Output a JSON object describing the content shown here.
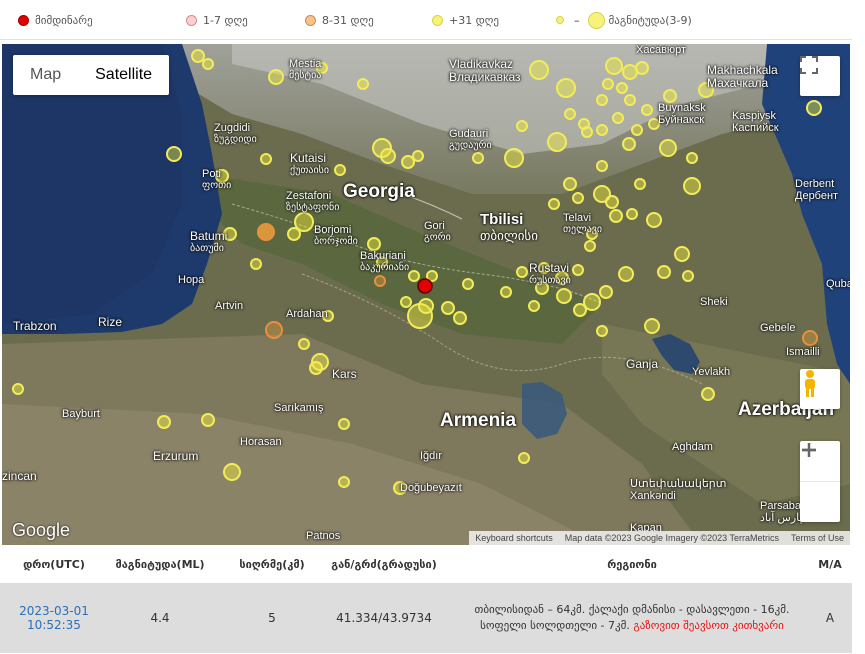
{
  "legend": {
    "today": "მიმდინარე",
    "d1_7": "1-7 დღე",
    "d8_31": "8-31 დღე",
    "d31plus": "+31 დღე",
    "magnitude": "მაგნიტუდა(3-9)",
    "dash": "–"
  },
  "map": {
    "map_btn": "Map",
    "satellite_btn": "Satellite",
    "google_logo": "Google",
    "attribution": {
      "shortcuts": "Keyboard shortcuts",
      "data": "Map data ©2023 Google Imagery ©2023 TerraMetrics",
      "terms": "Terms of Use"
    },
    "labels": [
      {
        "key": "mestia",
        "text": "Mestia",
        "sub": "მესტია"
      },
      {
        "key": "vladikavkaz",
        "text": "Vladikavkaz",
        "sub": "Владикавказ"
      },
      {
        "key": "khasavyurt",
        "text": "Хасавюрт",
        "sub": ""
      },
      {
        "key": "makhachkala",
        "text": "Makhachkala",
        "sub": "Махачкала"
      },
      {
        "key": "buynaksk",
        "text": "Buynaksk",
        "sub": "Буйнакск"
      },
      {
        "key": "kaspiysk",
        "text": "Kaspiysk",
        "sub": "Каспийск"
      },
      {
        "key": "zugdidi",
        "text": "Zugdidi",
        "sub": "ზუგდიდი"
      },
      {
        "key": "gudauri",
        "text": "Gudauri",
        "sub": "გუდაური"
      },
      {
        "key": "kutaisi",
        "text": "Kutaisi",
        "sub": "ქუთაისი"
      },
      {
        "key": "poti",
        "text": "Poti",
        "sub": "ფოთი"
      },
      {
        "key": "zestafoni",
        "text": "Zestafoni",
        "sub": "ზესტაფონი"
      },
      {
        "key": "georgia",
        "text": "Georgia",
        "sub": ""
      },
      {
        "key": "derbent",
        "text": "Derbent",
        "sub": "Дербент"
      },
      {
        "key": "telavi",
        "text": "Telavi",
        "sub": "თელავი"
      },
      {
        "key": "tbilisi",
        "text": "Tbilisi",
        "sub": "თბილისი"
      },
      {
        "key": "gori",
        "text": "Gori",
        "sub": "გორი"
      },
      {
        "key": "borjomi",
        "text": "Borjomi",
        "sub": "ბორჯომი"
      },
      {
        "key": "batumi",
        "text": "Batumi",
        "sub": "ბათუმი"
      },
      {
        "key": "bakuriani",
        "text": "Bakuriani",
        "sub": "ბაკურიანი"
      },
      {
        "key": "rustavi",
        "text": "Rustavi",
        "sub": "რუსთავი"
      },
      {
        "key": "hopa",
        "text": "Hopa",
        "sub": ""
      },
      {
        "key": "artvin",
        "text": "Artvin",
        "sub": ""
      },
      {
        "key": "quba",
        "text": "Quba",
        "sub": ""
      },
      {
        "key": "sheki",
        "text": "Sheki",
        "sub": ""
      },
      {
        "key": "ardahan",
        "text": "Ardahan",
        "sub": ""
      },
      {
        "key": "trabzon",
        "text": "Trabzon",
        "sub": ""
      },
      {
        "key": "rize",
        "text": "Rize",
        "sub": ""
      },
      {
        "key": "gebele",
        "text": "Gebele",
        "sub": ""
      },
      {
        "key": "ismailli",
        "text": "Ismailli",
        "sub": ""
      },
      {
        "key": "ganja",
        "text": "Ganja",
        "sub": ""
      },
      {
        "key": "yevlakh",
        "text": "Yevlakh",
        "sub": ""
      },
      {
        "key": "kars",
        "text": "Kars",
        "sub": ""
      },
      {
        "key": "azerbaijan",
        "text": "Azerbaijan",
        "sub": ""
      },
      {
        "key": "bayburt",
        "text": "Bayburt",
        "sub": ""
      },
      {
        "key": "sarikamis",
        "text": "Sarıkamış",
        "sub": ""
      },
      {
        "key": "armenia",
        "text": "Armenia",
        "sub": ""
      },
      {
        "key": "horasan",
        "text": "Horasan",
        "sub": ""
      },
      {
        "key": "aghdam",
        "text": "Aghdam",
        "sub": ""
      },
      {
        "key": "erzurum",
        "text": "Erzurum",
        "sub": ""
      },
      {
        "key": "igdir",
        "text": "Iğdır",
        "sub": ""
      },
      {
        "key": "xankendi",
        "text": "Ստեփանակերտ",
        "sub": "Xankəndi"
      },
      {
        "key": "zincan",
        "text": "zincan",
        "sub": ""
      },
      {
        "key": "dogubeyazit",
        "text": "Doğubeyazıt",
        "sub": ""
      },
      {
        "key": "parsabad",
        "text": "Parsabad",
        "sub": "پارس آباد"
      },
      {
        "key": "patnos",
        "text": "Patnos",
        "sub": ""
      },
      {
        "key": "kapan",
        "text": "Kapan",
        "sub": ""
      }
    ]
  },
  "table": {
    "headers": [
      "დრო(UTC)",
      "მაგნიტუდა(ML)",
      "სიღრმე(კმ)",
      "გან/გრძ(გრადუსი)",
      "რეგიონი",
      "M/A"
    ],
    "rows": [
      {
        "date": "2023-03-01",
        "time": "10:52:35",
        "magnitude": "4.4",
        "depth": "5",
        "coords": "41.334/43.9734",
        "region": "თბილისიდან – 64კმ. ქალაქი დმანისი - დასავლეთი - 16კმ. სოფელი სოლდთელი - 7კმ.",
        "region_link": "გაზოვით შეავსოთ კითხვარი",
        "ma": "A"
      }
    ]
  },
  "colors": {
    "today": "#e30000",
    "d1_7": "#f6b9b9",
    "d8_31": "#f2a85c",
    "d31plus": "#f5f06e"
  }
}
